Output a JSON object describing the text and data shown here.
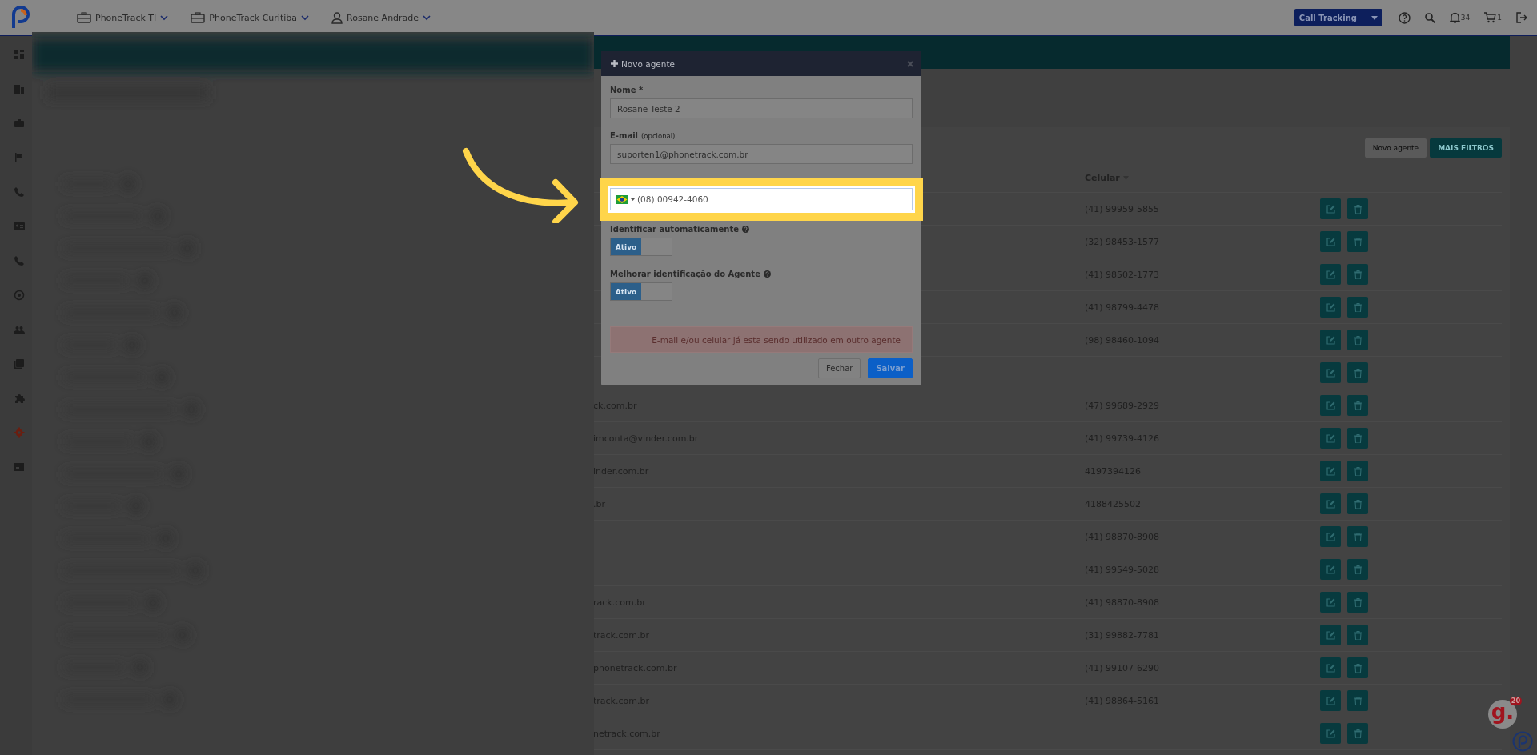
{
  "top_bar": {
    "menus": [
      {
        "label": "PhoneTrack TI",
        "kind": "company"
      },
      {
        "label": "PhoneTrack Curitiba",
        "kind": "company"
      },
      {
        "label": "Rosane Andrade",
        "kind": "user"
      }
    ],
    "product_select": "Call Tracking",
    "notifications": "34",
    "cart": "1"
  },
  "sidebar": {
    "items": [
      {
        "selected": false
      },
      {
        "selected": false
      },
      {
        "selected": false
      },
      {
        "selected": false
      },
      {
        "selected": false
      },
      {
        "selected": false
      },
      {
        "selected": false
      },
      {
        "selected": false
      },
      {
        "selected": false
      },
      {
        "selected": false
      },
      {
        "selected": false
      },
      {
        "selected": true
      },
      {
        "selected": false
      }
    ]
  },
  "toolbar": {
    "buttons": [
      {
        "label": "Novo agente",
        "kind": "plain"
      },
      {
        "label": "MAIS FILTROS",
        "kind": "primary"
      }
    ]
  },
  "table": {
    "celular_header": "Celular",
    "rows": [
      {
        "celular": "(41) 99959-5855"
      },
      {
        "celular": "(32) 98453-1577"
      },
      {
        "celular": "(41) 98502-1773"
      },
      {
        "celular": "(41) 98799-4478"
      },
      {
        "celular": "(98) 98460-1094"
      },
      {},
      {
        "email": "ck.com.br",
        "celular": "(47) 99689-2929"
      },
      {
        "email": "imconta@vinder.com.br",
        "celular": "(41) 99739-4126"
      },
      {
        "email": "inder.com.br",
        "celular": "4197394126"
      },
      {
        "email": ".br",
        "celular": "4188425502"
      },
      {
        "celular": "(41) 98870-8908"
      },
      {
        "celular": "(41) 99549-5028"
      },
      {
        "email": "rack.com.br",
        "celular": "(41) 98870-8908"
      },
      {
        "email": "track.com.br",
        "celular": "(31) 99882-7781"
      },
      {
        "email": "phonetrack.com.br",
        "celular": "(41) 99107-6290"
      },
      {
        "email": "track.com.br",
        "celular": "(41) 98864-5161"
      },
      {
        "email": "netrack.com.br"
      }
    ]
  },
  "modal": {
    "title": "Novo agente",
    "name_label": "Nome *",
    "name_value": "Rosane Teste 2",
    "email_label": "E-mail",
    "email_hint": "(opcional)",
    "email_value": "suporten1@phonetrack.com.br",
    "phone_value": "(08) 00942-4060",
    "toggles": [
      {
        "label": "Identificar automaticamente",
        "state_label": "Ativo",
        "on": true
      },
      {
        "label": "Melhorar identificação do Agente",
        "state_label": "Ativo",
        "on": true
      }
    ],
    "error": "E-mail e/ou celular já esta sendo utilizado em outro agente",
    "buttons": [
      {
        "label": "Fechar",
        "kind": "secondary"
      },
      {
        "label": "Salvar",
        "kind": "primary"
      }
    ]
  },
  "chat_widget": {
    "label": "g.",
    "badge": "20"
  }
}
